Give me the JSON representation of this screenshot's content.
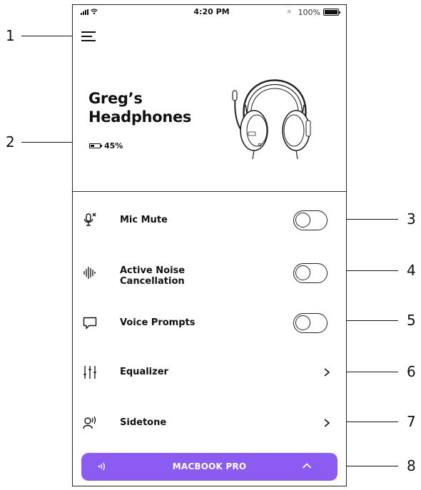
{
  "status_bar": {
    "time": "4:20 PM",
    "battery_percent": "100%",
    "battery_level": 1.0,
    "icons": [
      "signal-icon",
      "wifi-icon",
      "bluetooth-icon",
      "battery-icon"
    ]
  },
  "header": {
    "menu_icon": "hamburger-menu-icon",
    "device_name_line1": "Greg’s",
    "device_name_line2": "Headphones",
    "battery_label": "45%",
    "battery_level": 0.45,
    "image": "headphones-illustration"
  },
  "settings": [
    {
      "label": "Mic Mute",
      "icon": "mic-mute-icon",
      "control": "toggle",
      "on": false
    },
    {
      "label_line1": "Active Noise",
      "label_line2": "Cancellation",
      "icon": "noise-cancellation-icon",
      "control": "toggle",
      "on": false
    },
    {
      "label": "Voice Prompts",
      "icon": "voice-prompts-icon",
      "control": "toggle",
      "on": false
    },
    {
      "label": "Equalizer",
      "icon": "equalizer-icon",
      "control": "chevron"
    },
    {
      "label": "Sidetone",
      "icon": "sidetone-icon",
      "control": "chevron"
    }
  ],
  "device_bar": {
    "label": "MACBOOK PRO",
    "icon": "audio-output-icon",
    "expand_icon": "chevron-up-icon",
    "color": "#8c5cf2"
  },
  "callouts": [
    "1",
    "2",
    "3",
    "4",
    "5",
    "6",
    "7",
    "8"
  ]
}
